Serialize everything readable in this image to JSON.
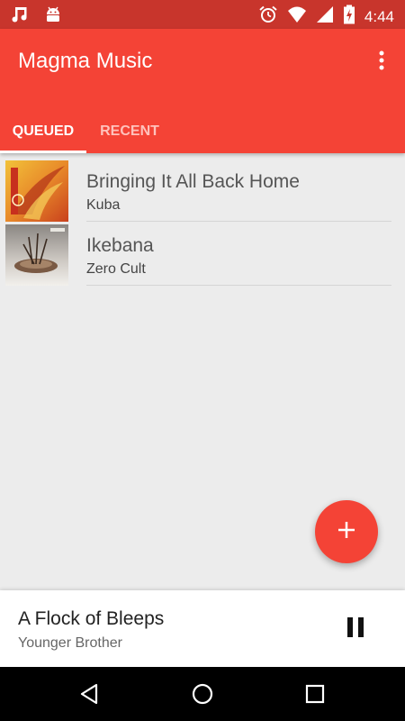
{
  "status_bar": {
    "time": "4:44",
    "icons": [
      "music-note-icon",
      "android-icon",
      "alarm-icon",
      "wifi-icon",
      "signal-icon",
      "battery-charging-icon"
    ]
  },
  "app_bar": {
    "title": "Magma Music",
    "menu_icon": "more-vert-icon",
    "color": "#f44336",
    "tabs": [
      {
        "label": "QUEUED",
        "selected": true
      },
      {
        "label": "RECENT",
        "selected": false
      }
    ]
  },
  "queue": [
    {
      "title": "Bringing It All Back Home",
      "artist": "Kuba"
    },
    {
      "title": "Ikebana",
      "artist": "Zero Cult"
    }
  ],
  "fab": {
    "icon": "plus-icon"
  },
  "now_playing": {
    "title": "A Flock of Bleeps",
    "artist": "Younger Brother",
    "control_icon": "pause-icon"
  },
  "nav_bar": {
    "icons": [
      "back-icon",
      "home-icon",
      "recents-icon"
    ]
  }
}
